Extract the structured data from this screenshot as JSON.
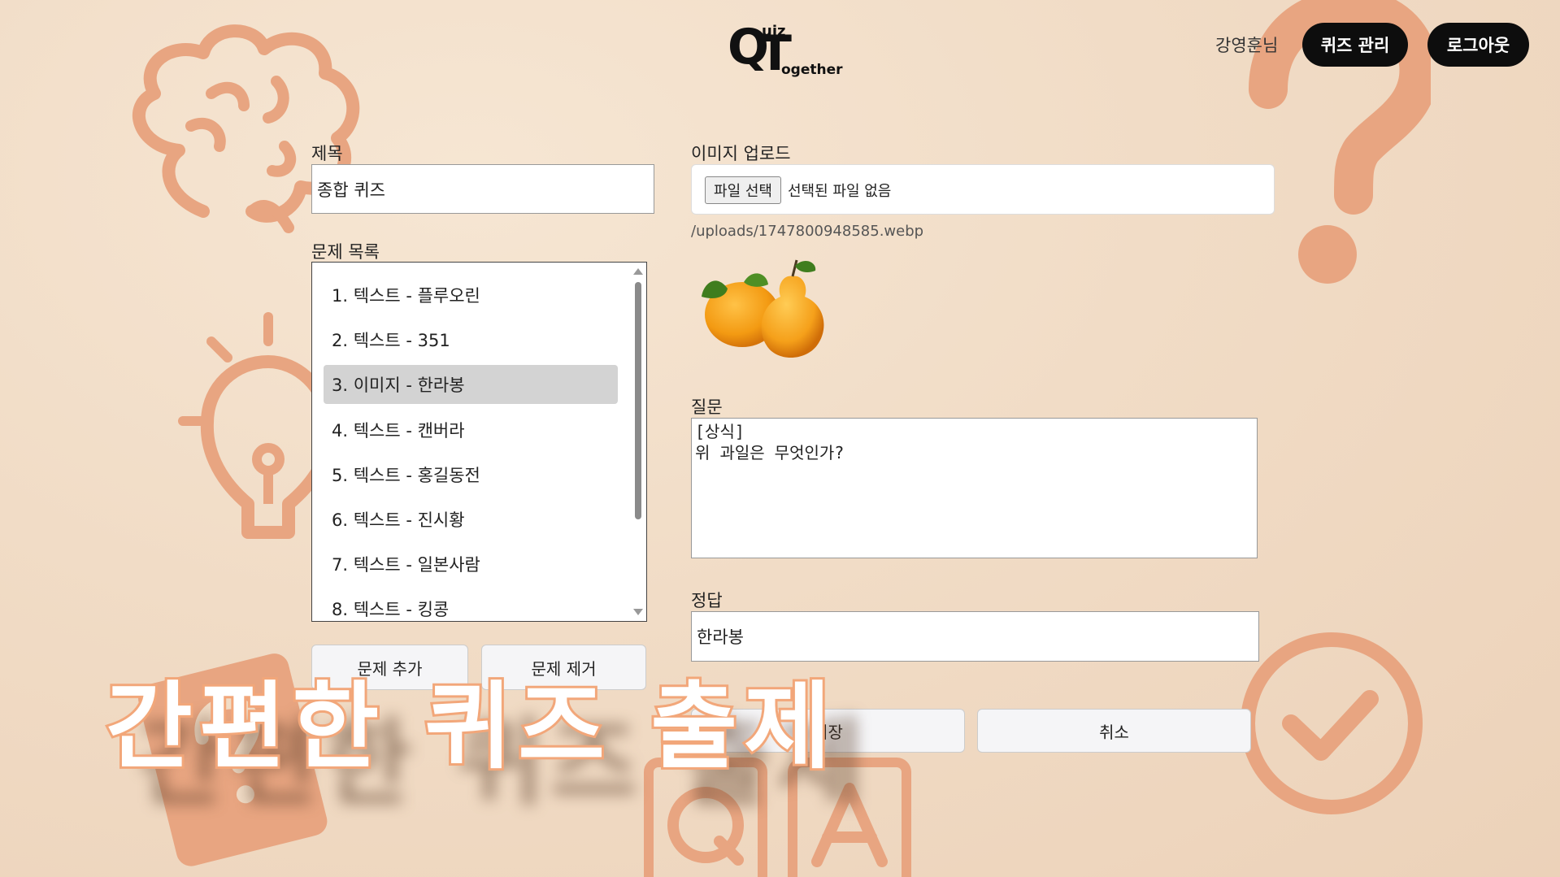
{
  "header": {
    "logo": {
      "q": "Q",
      "uiz": "uiz",
      "t": "T",
      "ogether": "ogether"
    },
    "user_name": "강영훈님",
    "manage_button": "퀴즈 관리",
    "logout_button": "로그아웃"
  },
  "form": {
    "title_label": "제목",
    "title_value": "종합 퀴즈",
    "list_label": "문제 목록",
    "questions": [
      {
        "label": "1. 텍스트 - 플루오린",
        "selected": false
      },
      {
        "label": "2. 텍스트 - 351",
        "selected": false
      },
      {
        "label": "3. 이미지 - 한라봉",
        "selected": true
      },
      {
        "label": "4. 텍스트 - 캔버라",
        "selected": false
      },
      {
        "label": "5. 텍스트 - 홍길동전",
        "selected": false
      },
      {
        "label": "6. 텍스트 - 진시황",
        "selected": false
      },
      {
        "label": "7. 텍스트 - 일본사람",
        "selected": false
      },
      {
        "label": "8. 텍스트 - 킹콩",
        "selected": false
      }
    ],
    "add_question_button": "문제 추가",
    "remove_question_button": "문제 제거",
    "image_label": "이미지 업로드",
    "file_button": "파일 선택",
    "file_status": "선택된 파일 없음",
    "upload_path": "/uploads/1747800948585.webp",
    "question_label": "질문",
    "question_value": "[상식]\n위 과일은 무엇인가?",
    "answer_label": "정답",
    "answer_value": "한라봉",
    "save_button": "저장",
    "cancel_button": "취소"
  },
  "overlay": {
    "title": "간편한 퀴즈 출제"
  },
  "colors": {
    "background": "#f1dcc6",
    "decoration": "#e8a581",
    "overlay_stroke": "#f2a77a",
    "selected_item": "#d3d3d3",
    "dark_button": "#0d0d0d"
  }
}
